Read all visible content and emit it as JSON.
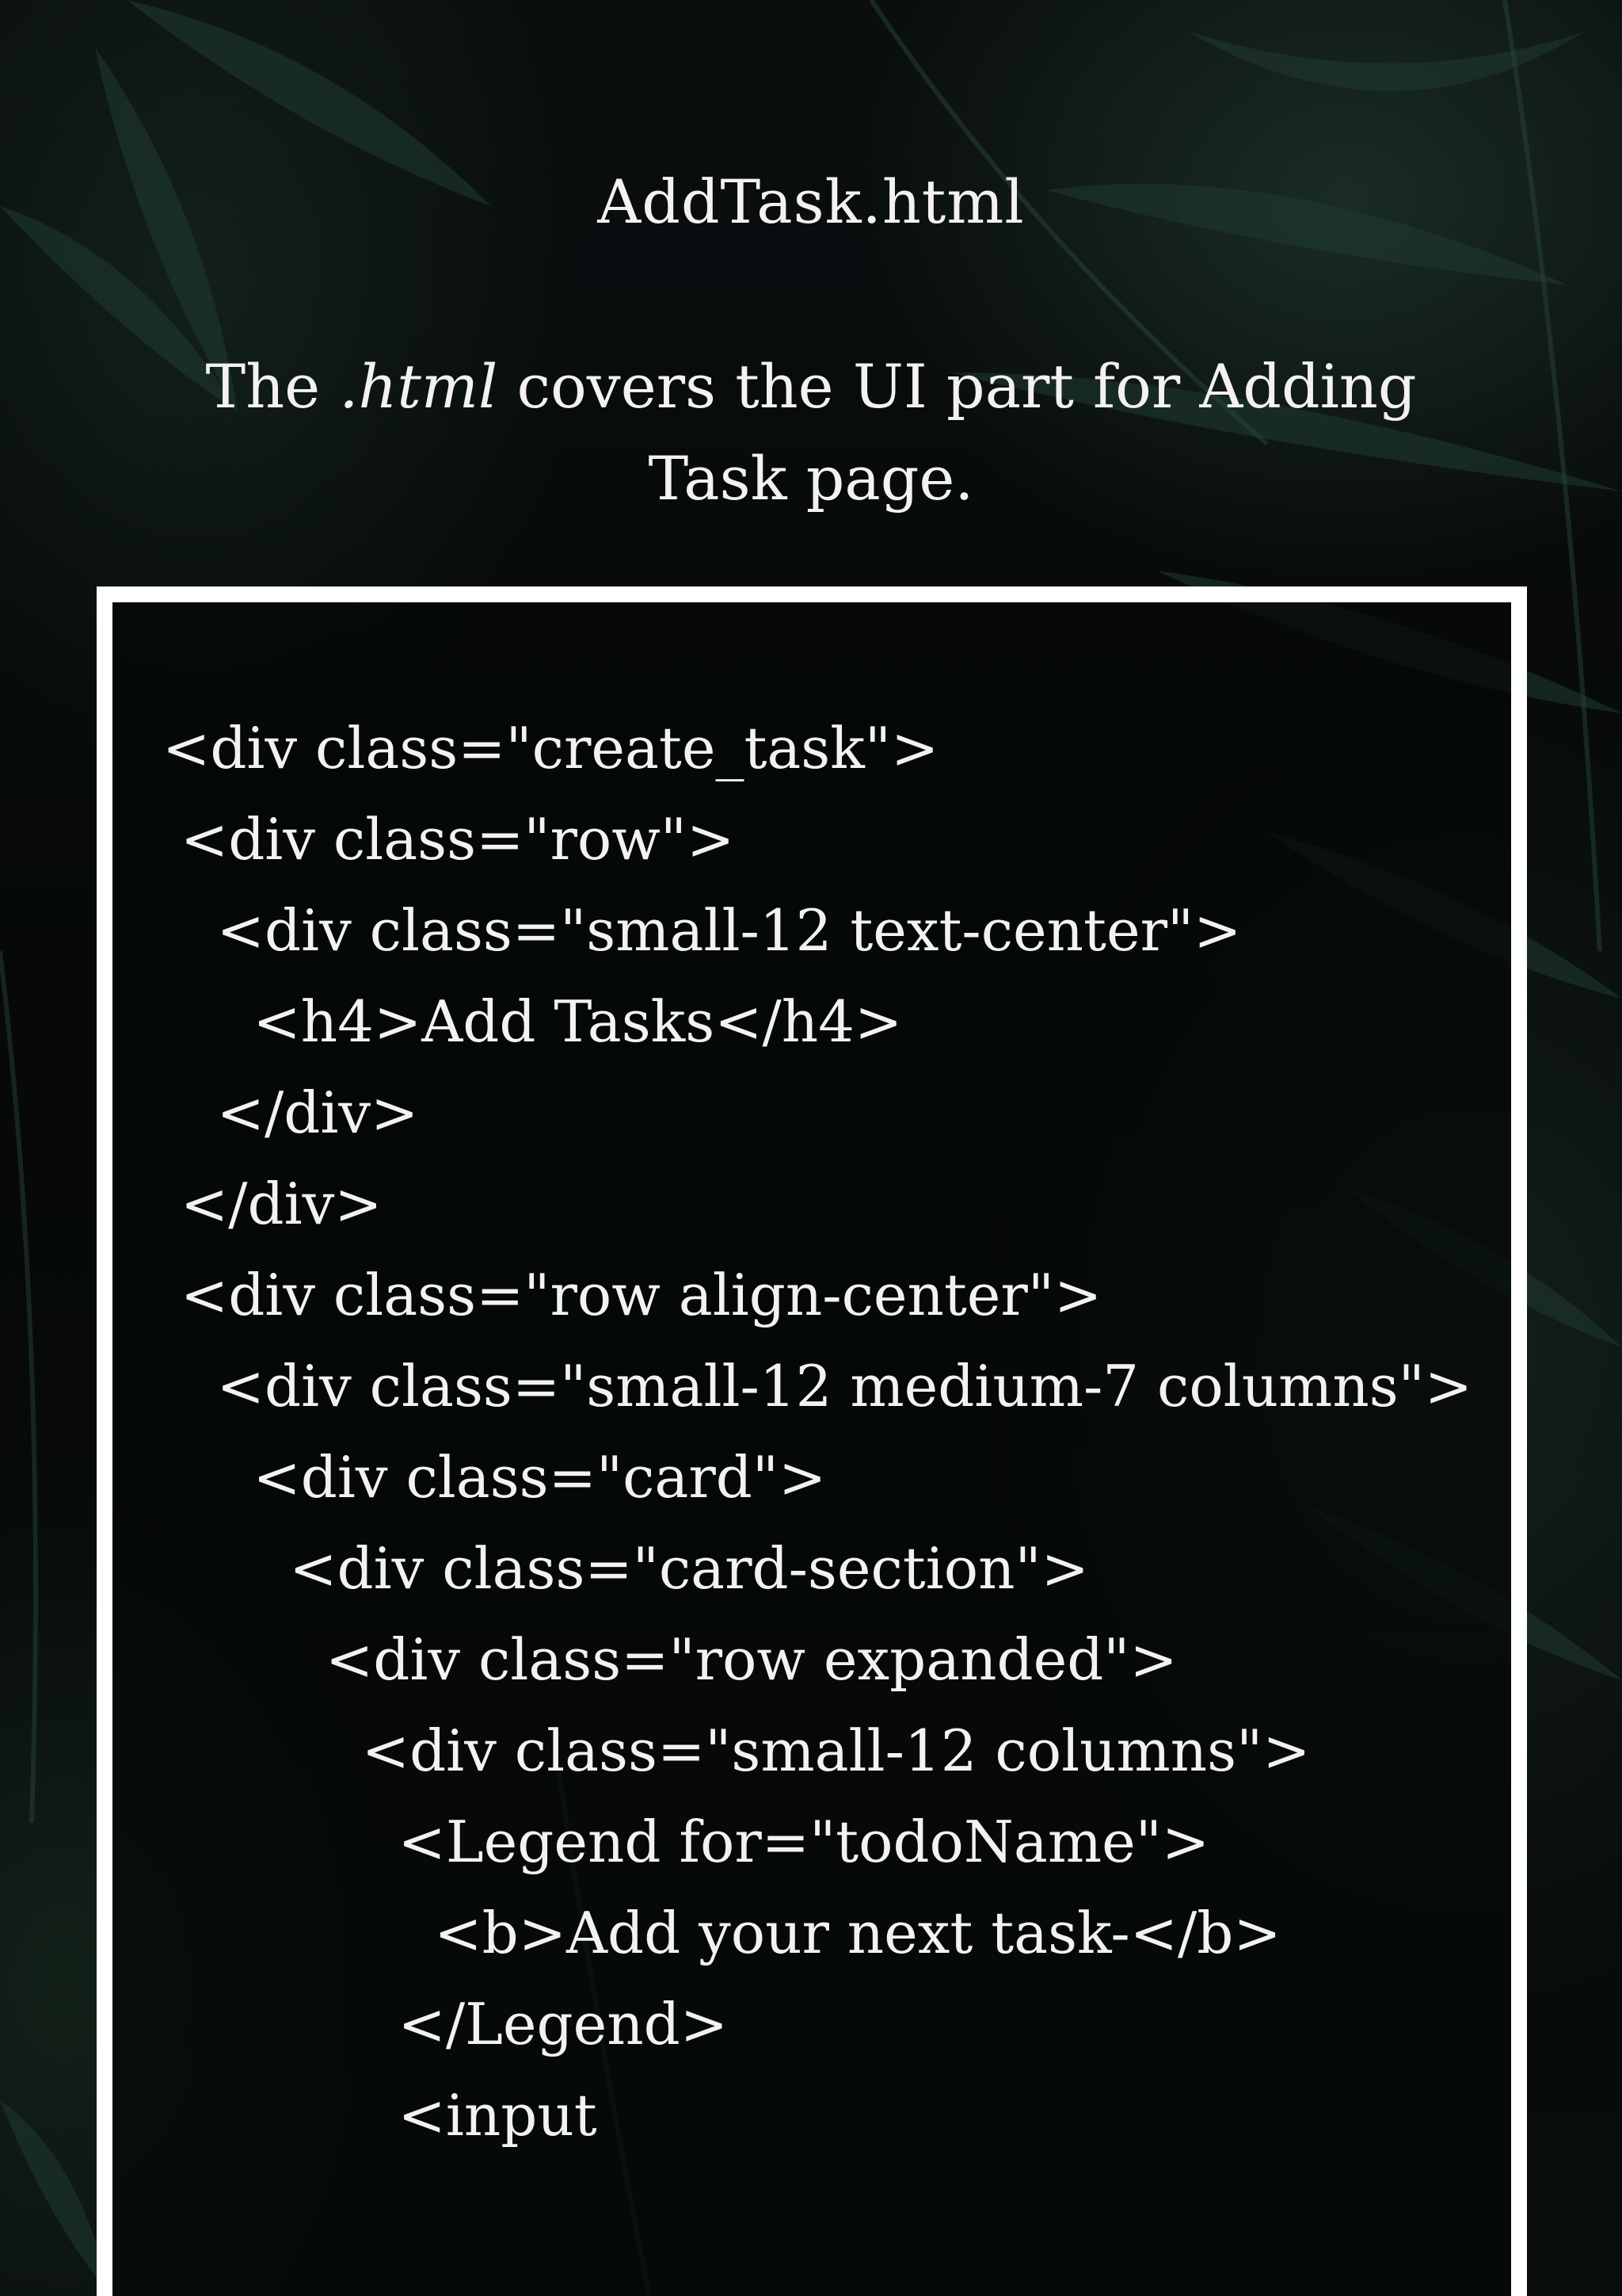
{
  "document": {
    "title": "AddTask.html",
    "intro": {
      "before": "The ",
      "emphasis": ".html",
      "after": " covers the UI part for Adding Task page."
    }
  },
  "code": {
    "lines": [
      "<div class=\"create_task\">",
      " <div class=\"row\">",
      "   <div class=\"small-12 text-center\">",
      "     <h4>Add Tasks</h4>",
      "   </div>",
      " </div>",
      " <div class=\"row align-center\">",
      "   <div class=\"small-12 medium-7 columns\">",
      "     <div class=\"card\">",
      "       <div class=\"card-section\">",
      "         <div class=\"row expanded\">",
      "           <div class=\"small-12 columns\">",
      "             <Legend for=\"todoName\">",
      "               <b>Add your next task-</b>",
      "             </Legend>",
      "             <input"
    ]
  },
  "background": {
    "base_color": "#07090a",
    "foliage_color": "#1f3b30",
    "frame_color": "#ffffff",
    "text_color": "#f4f2ee"
  }
}
